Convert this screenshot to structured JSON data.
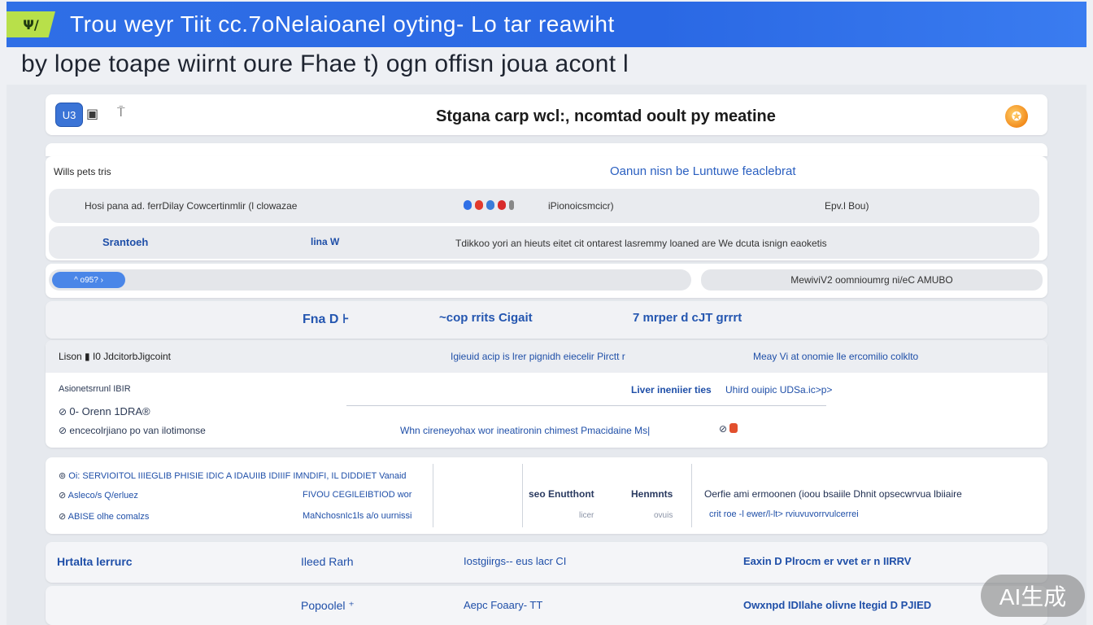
{
  "window": {
    "logo_text": "Ψ/",
    "title": "Trou weyr Tiit cc.7oNelaioanel oyting- Lo tar reawiht"
  },
  "subtitle": "by  lope toape wiirnt  oure Fhae  t) ogn offisn joua acont l",
  "header": {
    "badge_label": "U3",
    "icon_a": "▣",
    "icon_b": "⍑",
    "title": "Stgana carp wcl:‚ ncomtad ooult py meatine",
    "user_icon": "✪"
  },
  "panel_a": {
    "label": "Wills pets tris",
    "link": "Oanun nisn be Luntuwe feaclebrat",
    "row1": {
      "left": "Hosi pana ad. ferrDilay Cowcertinmlir (l clowazae",
      "mid": "iPionoicsmcicr)",
      "right": "Epv.l Bou)"
    },
    "row2": {
      "col1": "Srantoeh",
      "col2": "lina W",
      "col3": "Tdikkoo yori an hieuts eitet cit ontarest lasremmy loaned are We dcuta isnign eaoketis"
    },
    "dot_colors": [
      "#2f6fe6",
      "#e23b2e",
      "#3a7cd9",
      "#d82b2b",
      "#888888"
    ]
  },
  "panel_b": {
    "search_label": "^  o95? ›",
    "status": "MewiviV2 oomnioumrg ni/eC AMUBO"
  },
  "tabs": [
    {
      "label": "Fna D  ⊦"
    },
    {
      "label": "~cop rrits Cigait"
    },
    {
      "label": "7  mrper d cJT grrr​t"
    }
  ],
  "panel_d": {
    "head_left": "Lison ▮ I0 JdcitorbJigcoint",
    "head_mid": "Igieuid acip is lrer pignidh eiecelir Pirctt r",
    "head_right": "Meay Vi at onomie lle ercomilio colklto",
    "sub_left": "Asionetsrrunl IBIR",
    "sub_mid": "Liver ineniier ties",
    "sub_right": "Uhird ouipic UDSa.ic>p>",
    "item1": "0- Orenn 1DRA®",
    "item2": "encecolrjiano po van ilotimonse",
    "item2_mid": "Whn cireneyohax wor ineatironin chimest Pmacidaine   Ms|",
    "item1_icon": "⊘",
    "item2_icon": "⊘"
  },
  "panel_e": {
    "rows": [
      {
        "icon": "⊚",
        "text": "Oi: SERVIOITOL IIIEGLIB PHISIE IDIC A IDAUIIB IDIIIF IMNDIFI, IL DIDDIET Vanaid"
      },
      {
        "icon": "⊘",
        "text": "Asleco/s Q/erluez",
        "mid": "FIVOU CEGILEIBTIOD wor"
      },
      {
        "icon": "⊘",
        "text": "ABISE olhe comalzs",
        "mid": "MaNchosnIc1ls a/o uurnissi"
      }
    ],
    "col_a": "seo Enutthont",
    "col_a_sub": "licer",
    "col_b": "Henmnts",
    "col_b_sub": "ovuis",
    "col_c": "Oerfie ami ermoonen (ioou bsaiile Dhnit  opsecwrvua lbiiaire",
    "col_c_sub": "crit roe -l ewer/l-lt> rviuvuvorrvulcerrei"
  },
  "panel_f": {
    "c1": "Hrtalta lerrurc",
    "c2": "Ileed Rarh",
    "c3": "Iostgiirgs-- eus lacr CI",
    "c4": "Eaxin D Plrocm er vvet er n IIRRV"
  },
  "panel_g": {
    "c2": "Popoolel  ⁺",
    "c3": "Aepc  Foaary-  TT",
    "c4": "Owxnpd IDIlahe olivne ltegid D PJIED"
  },
  "watermark": "AI生成"
}
